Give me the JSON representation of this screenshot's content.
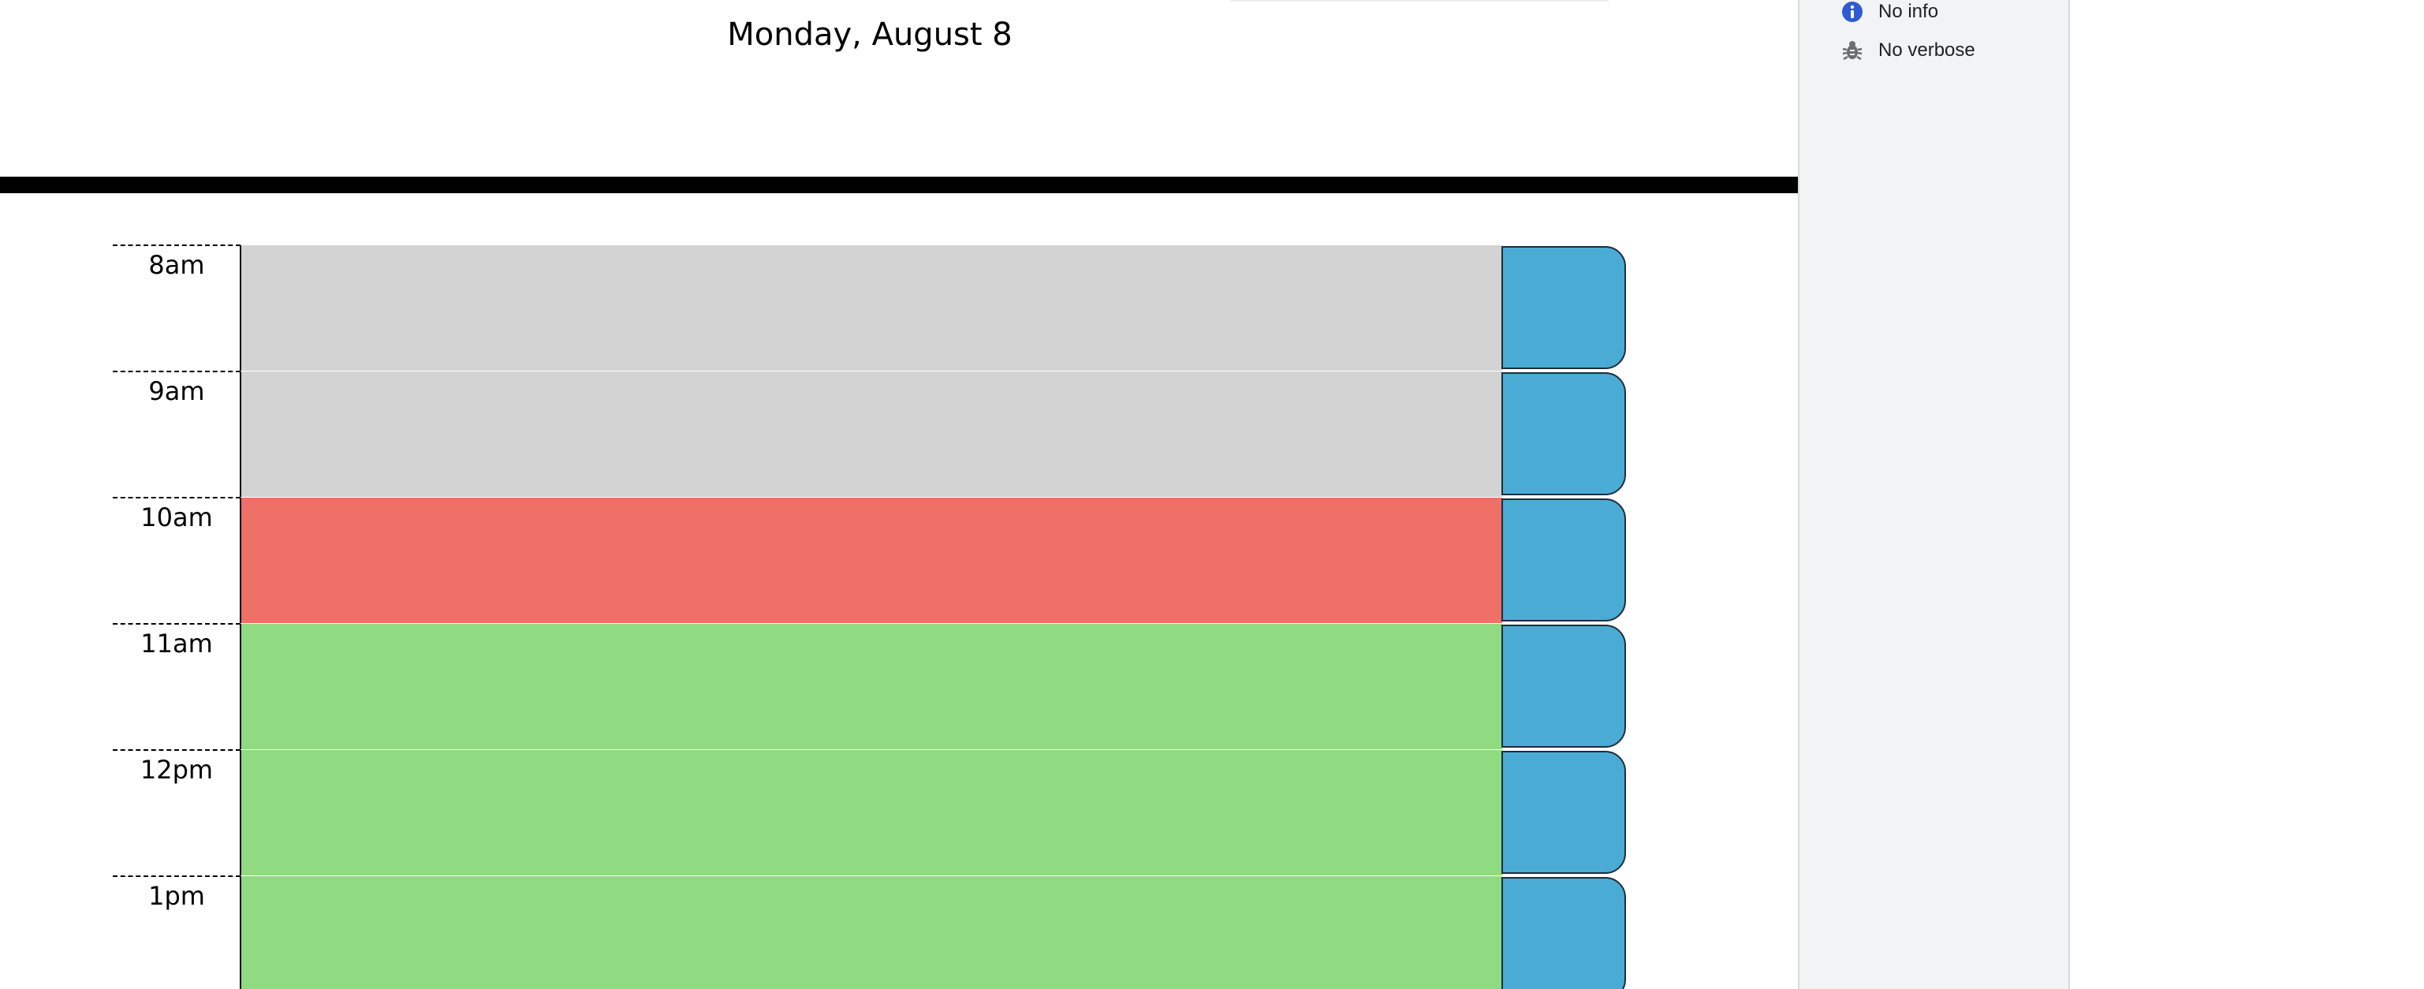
{
  "header": {
    "current_day": "Monday, August 8"
  },
  "schedule": {
    "rows": [
      {
        "hour": "8am",
        "status": "past",
        "task": ""
      },
      {
        "hour": "9am",
        "status": "past",
        "task": ""
      },
      {
        "hour": "10am",
        "status": "present",
        "task": ""
      },
      {
        "hour": "11am",
        "status": "future",
        "task": ""
      },
      {
        "hour": "12pm",
        "status": "future",
        "task": ""
      },
      {
        "hour": "1pm",
        "status": "future",
        "task": ""
      }
    ]
  },
  "devtools_sidebar": {
    "items": [
      {
        "icon": "info-icon",
        "label": "No info"
      },
      {
        "icon": "bug-icon",
        "label": "No verbose"
      }
    ]
  },
  "colors": {
    "past": "#d3d3d3",
    "present": "#ee7067",
    "future": "#90da82",
    "save_button": "#4aacd4",
    "info_icon": "#2f5bd2",
    "bug_icon": "#6e6e6e"
  }
}
